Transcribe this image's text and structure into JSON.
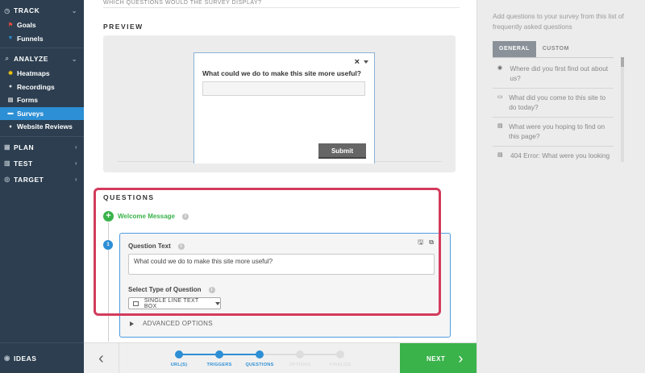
{
  "sidebar": {
    "track": "TRACK",
    "goals": "Goals",
    "funnels": "Funnels",
    "analyze": "ANALYZE",
    "heatmaps": "Heatmaps",
    "recordings": "Recordings",
    "forms": "Forms",
    "surveys": "Surveys",
    "website_reviews": "Website Reviews",
    "plan": "PLAN",
    "test": "TEST",
    "target": "TARGET",
    "ideas": "IDEAS"
  },
  "main": {
    "top_question": "WHICH QUESTIONS WOULD THE SURVEY DISPLAY?",
    "preview_label": "PREVIEW",
    "preview": {
      "question": "What could we do to make this site more useful?",
      "submit": "Submit"
    },
    "questions_label": "QUESTIONS",
    "welcome_message": "Welcome Message",
    "step_number": "1",
    "question_text_label": "Question Text",
    "question_text_value": "What could we do to make this site more useful?",
    "select_type_label": "Select Type of Question",
    "select_type_value": "SINGLE LINE TEXT BOX",
    "advanced_options": "ADVANCED OPTIONS"
  },
  "footer": {
    "steps": [
      {
        "label": "URL(S)",
        "done": true
      },
      {
        "label": "TRIGGERS",
        "done": true
      },
      {
        "label": "QUESTIONS",
        "done": true
      },
      {
        "label": "OPTIONS",
        "done": false
      },
      {
        "label": "FINALIZE",
        "done": false
      }
    ],
    "next": "NEXT"
  },
  "right_panel": {
    "intro": "Add questions to your survey from this list of frequently asked questions",
    "tab_general": "GENERAL",
    "tab_custom": "CUSTOM",
    "questions": [
      {
        "icon": "radio-icon",
        "text": "Where did you first find out about us?"
      },
      {
        "icon": "textbox-icon",
        "text": "What did you come to this site to do today?"
      },
      {
        "icon": "textarea-icon",
        "text": "What were you hoping to find on this page?"
      },
      {
        "icon": "textarea-icon",
        "text": "404 Error: What were you looking"
      }
    ]
  },
  "colors": {
    "sidebar_bg": "#2c3e50",
    "accent_blue": "#2d8fd5",
    "green": "#3ab34a",
    "highlight_red": "#d33b5c"
  }
}
